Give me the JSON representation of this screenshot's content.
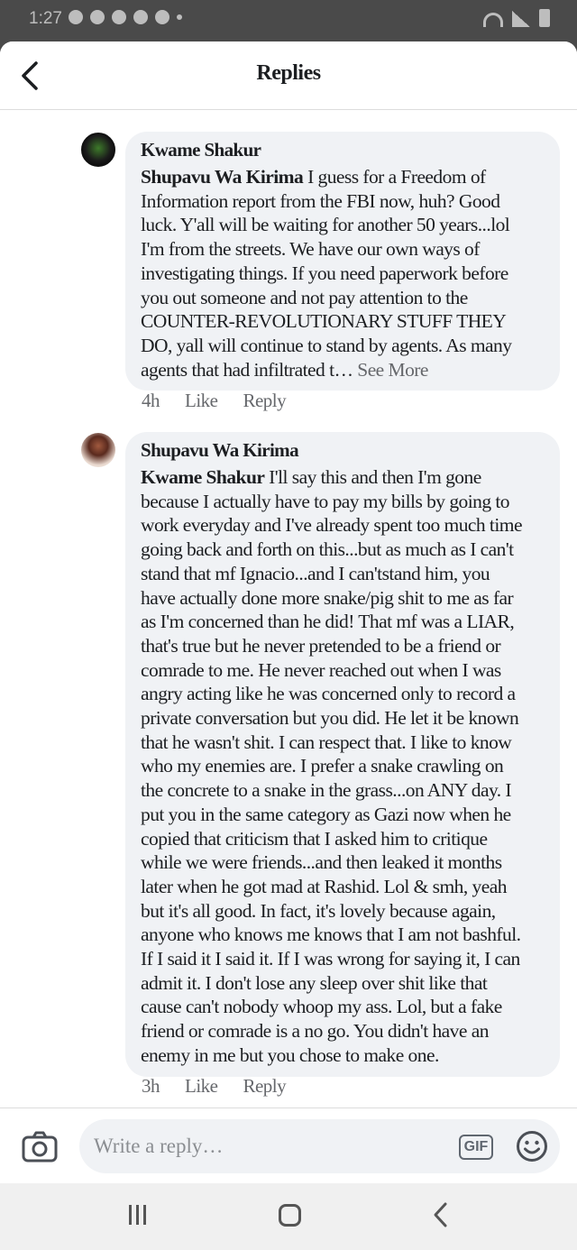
{
  "status_bar": {
    "time": "1:27",
    "notification_icons": [
      "shield-icon",
      "person-icon",
      "messenger-icon",
      "grid-icon",
      "cloud-upload-icon",
      "dot-icon"
    ],
    "right_icons": [
      "wifi-icon",
      "signal-icon",
      "battery-icon"
    ]
  },
  "header": {
    "title": "Replies",
    "back_icon": "chevron-left-icon"
  },
  "comments": [
    {
      "author": "Kwame Shakur",
      "mention": "Shupavu Wa Kirima",
      "text_lines": [
        " I guess for a Freedom of",
        "Information report from the FBI now, huh? Good",
        "luck. Y'all will be waiting for another 50 years...lol",
        "I'm from the streets. We have our own ways of",
        "investigating things. If you need paperwork before",
        "you out someone and not pay attention to the",
        "COUNTER-REVOLUTIONARY STUFF THEY",
        "DO, yall will continue to stand by agents. As many",
        "agents that had infiltrated t… "
      ],
      "see_more": "See More",
      "time": "4h",
      "like_label": "Like",
      "reply_label": "Reply"
    },
    {
      "author": "Shupavu Wa Kirima",
      "mention": "Kwame Shakur",
      "text_lines": [
        " I'll say this and then I'm gone",
        "because I actually have to pay my bills by going to",
        "work everyday and I've already spent too much time",
        "going back and forth on this...but as much as I can't",
        "stand that mf Ignacio...and I can'tstand him, you",
        "have actually done more snake/pig shit to me as far",
        "as I'm concerned than he did! That mf was a LIAR,",
        "that's true but he never pretended to be a friend or",
        "comrade to me. He never reached out when I was",
        "angry acting like he was concerned only to record a",
        "private conversation but you did. He let it be known",
        "that he wasn't shit. I can respect that. I like to know",
        "who my enemies are. I prefer a snake crawling on",
        "the concrete to a snake in the grass...on ANY day. I",
        "put you in the same category as Gazi now when he",
        "copied that criticism that I asked him to critique",
        "while we were friends...and then leaked it months",
        "later when he got mad at Rashid. Lol & smh, yeah",
        "but it's all good. In fact, it's lovely because again,",
        "anyone who knows me knows that I am not bashful.",
        "If I said it I said it. If I was wrong for saying it, I can",
        "admit it. I don't lose any sleep over shit like that",
        "cause can't nobody whoop my ass. Lol, but a fake",
        "friend or comrade is a no go. You didn't have an",
        "enemy in me but you chose to make one."
      ],
      "time": "3h",
      "like_label": "Like",
      "reply_label": "Reply"
    }
  ],
  "composer": {
    "placeholder": "Write a reply…",
    "gif_label": "GIF",
    "camera_icon": "camera-icon",
    "emoji_icon": "smiley-icon"
  },
  "navbar": {
    "icons": [
      "recent-apps-icon",
      "home-icon",
      "back-icon"
    ]
  },
  "colors": {
    "bubble": "#f0f2f5",
    "secondary_text": "#65676b",
    "status_bar_bg": "#4a4a4a"
  }
}
